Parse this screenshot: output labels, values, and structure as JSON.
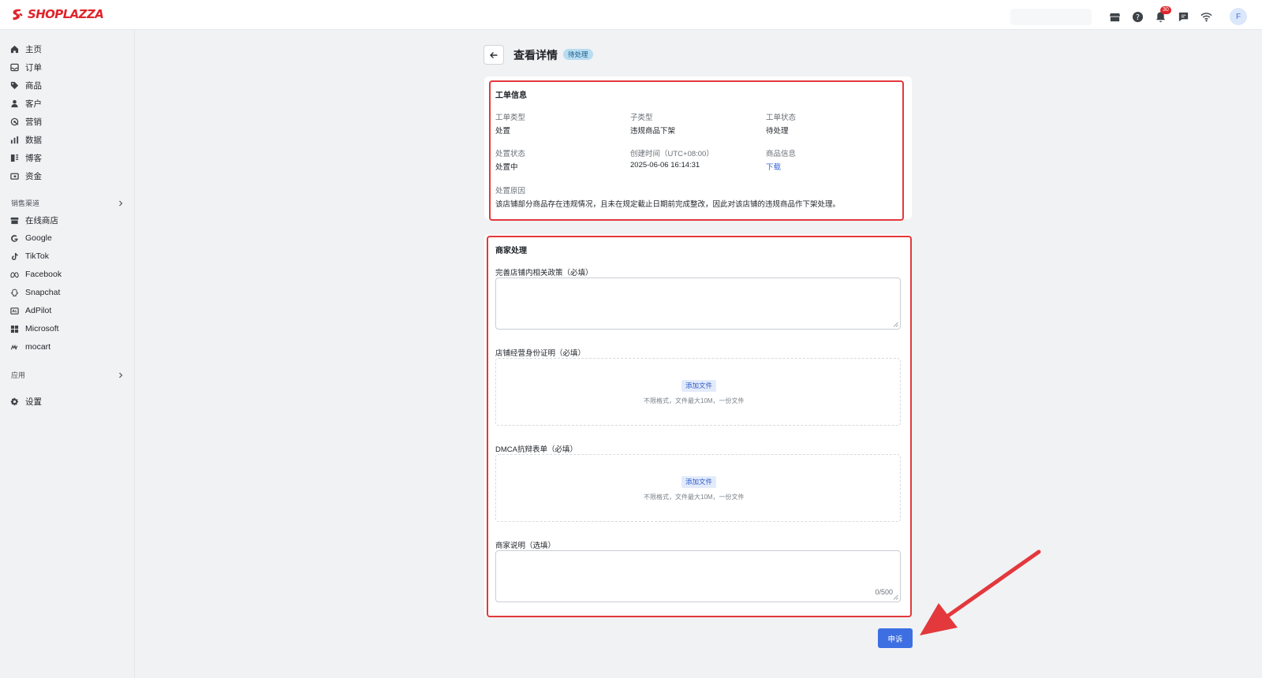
{
  "brand": {
    "name": "SHOPLAZZA"
  },
  "topbar": {
    "notification_count": "30",
    "avatar_initial": "F"
  },
  "sidebar": {
    "items": [
      {
        "label": "主页",
        "icon": "home-icon"
      },
      {
        "label": "订单",
        "icon": "inbox-icon"
      },
      {
        "label": "商品",
        "icon": "tag-icon"
      },
      {
        "label": "客户",
        "icon": "person-icon"
      },
      {
        "label": "营销",
        "icon": "target-icon"
      },
      {
        "label": "数据",
        "icon": "bar-chart-icon"
      },
      {
        "label": "博客",
        "icon": "blog-icon"
      },
      {
        "label": "资金",
        "icon": "wallet-icon"
      }
    ],
    "sales_channels_heading": "销售渠道",
    "channels": [
      {
        "label": "在线商店",
        "icon": "store-icon"
      },
      {
        "label": "Google",
        "icon": "google-icon"
      },
      {
        "label": "TikTok",
        "icon": "tiktok-icon"
      },
      {
        "label": "Facebook",
        "icon": "meta-icon"
      },
      {
        "label": "Snapchat",
        "icon": "snapchat-icon"
      },
      {
        "label": "AdPilot",
        "icon": "adpilot-icon"
      },
      {
        "label": "Microsoft",
        "icon": "microsoft-icon"
      },
      {
        "label": "mocart",
        "icon": "mocart-icon"
      }
    ],
    "apps_heading": "应用",
    "settings_label": "设置"
  },
  "header": {
    "title": "查看详情",
    "status": "待处理"
  },
  "ticket": {
    "title": "工单信息",
    "fields": [
      {
        "label": "工单类型",
        "value": "处置"
      },
      {
        "label": "子类型",
        "value": "违规商品下架"
      },
      {
        "label": "工单状态",
        "value": "待处理"
      },
      {
        "label": "处置状态",
        "value": "处置中"
      },
      {
        "label": "创建时间（UTC+08:00）",
        "value": "2025-06-06 16:14:31"
      },
      {
        "label": "商品信息",
        "value": "下载"
      }
    ],
    "reason_label": "处置原因",
    "reason_text": "该店铺部分商品存在违规情况，且未在规定截止日期前完成整改，因此对该店铺的违规商品作下架处理。"
  },
  "merchant": {
    "title": "商家处理",
    "policy_label": "完善店铺内相关政策（必填）",
    "identity_label": "店铺经营身份证明（必填）",
    "dmca_label": "DMCA抗辩表单（必填）",
    "note_label": "商家说明（选填）",
    "add_file_label": "添加文件",
    "upload_hint": "不限格式，文件最大10M，一份文件",
    "note_counter": "0/500"
  },
  "submit_label": "申诉",
  "colors": {
    "brand_red": "#e0252b",
    "primary": "#3d6fe3",
    "highlight": "#e3383c"
  }
}
